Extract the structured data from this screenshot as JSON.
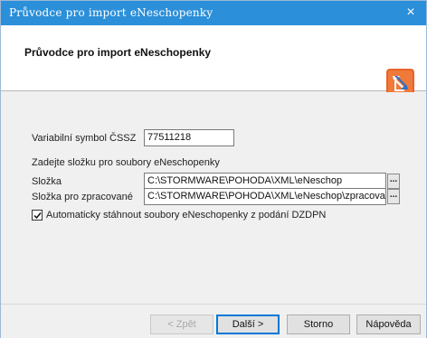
{
  "window": {
    "title": "Průvodce pro import eNeschopenky",
    "close_glyph": "×"
  },
  "header": {
    "heading": "Průvodce pro import eNeschopenky",
    "logo_icon": "pohoda-logo-icon"
  },
  "form": {
    "variable_symbol_label": "Variabilní symbol ČSSZ",
    "variable_symbol_value": "77511218",
    "folder_section_label": "Zadejte složku pro soubory eNeschopenky",
    "folder_label": "Složka",
    "folder_value": "C:\\STORMWARE\\POHODA\\XML\\eNeschop",
    "processed_folder_label": "Složka pro zpracované",
    "processed_folder_value": "C:\\STORMWARE\\POHODA\\XML\\eNeschop\\zpracovane",
    "browse_glyph": "...",
    "auto_download_label": "Automaticky stáhnout soubory eNeschopenky z podání DZDPN",
    "auto_download_checked": true
  },
  "buttons": {
    "back": "< Zpět",
    "next": "Další >",
    "cancel": "Storno",
    "help": "Nápověda"
  },
  "colors": {
    "titlebar": "#2b8fd9",
    "logo_orange": "#e8642a",
    "logo_blue": "#2f6fc4"
  }
}
